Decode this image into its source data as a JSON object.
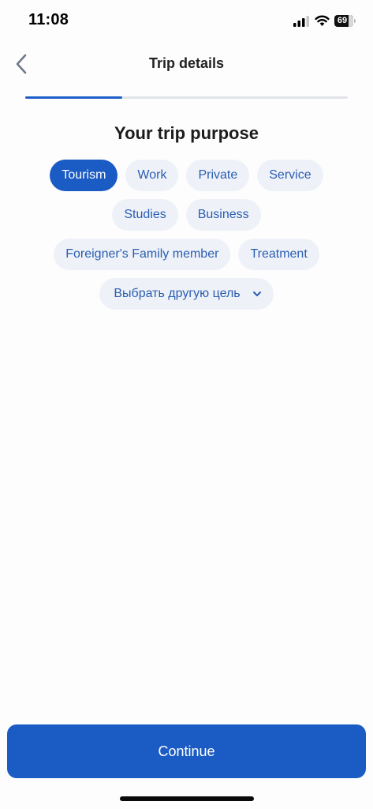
{
  "status_bar": {
    "time": "11:08",
    "battery_level": "69",
    "icons": [
      "signal-icon",
      "wifi-icon",
      "battery-icon"
    ]
  },
  "header": {
    "title": "Trip details",
    "back_icon": "chevron-left-icon"
  },
  "progress": {
    "fraction": 0.3
  },
  "main": {
    "section_title": "Your trip purpose",
    "purposes": [
      {
        "label": "Tourism",
        "selected": true
      },
      {
        "label": "Work",
        "selected": false
      },
      {
        "label": "Private",
        "selected": false
      },
      {
        "label": "Service",
        "selected": false
      },
      {
        "label": "Studies",
        "selected": false
      },
      {
        "label": "Business",
        "selected": false
      },
      {
        "label": "Foreigner's Family member",
        "selected": false
      },
      {
        "label": "Treatment",
        "selected": false
      }
    ],
    "other_purpose_label": "Выбрать другую цель",
    "other_purpose_icon": "chevron-down-icon"
  },
  "footer": {
    "continue_label": "Continue"
  },
  "colors": {
    "accent": "#1b5bc4",
    "chip_background": "#eef2f8",
    "chip_text": "#2a5db3",
    "progress_track": "#e1e4ea"
  }
}
